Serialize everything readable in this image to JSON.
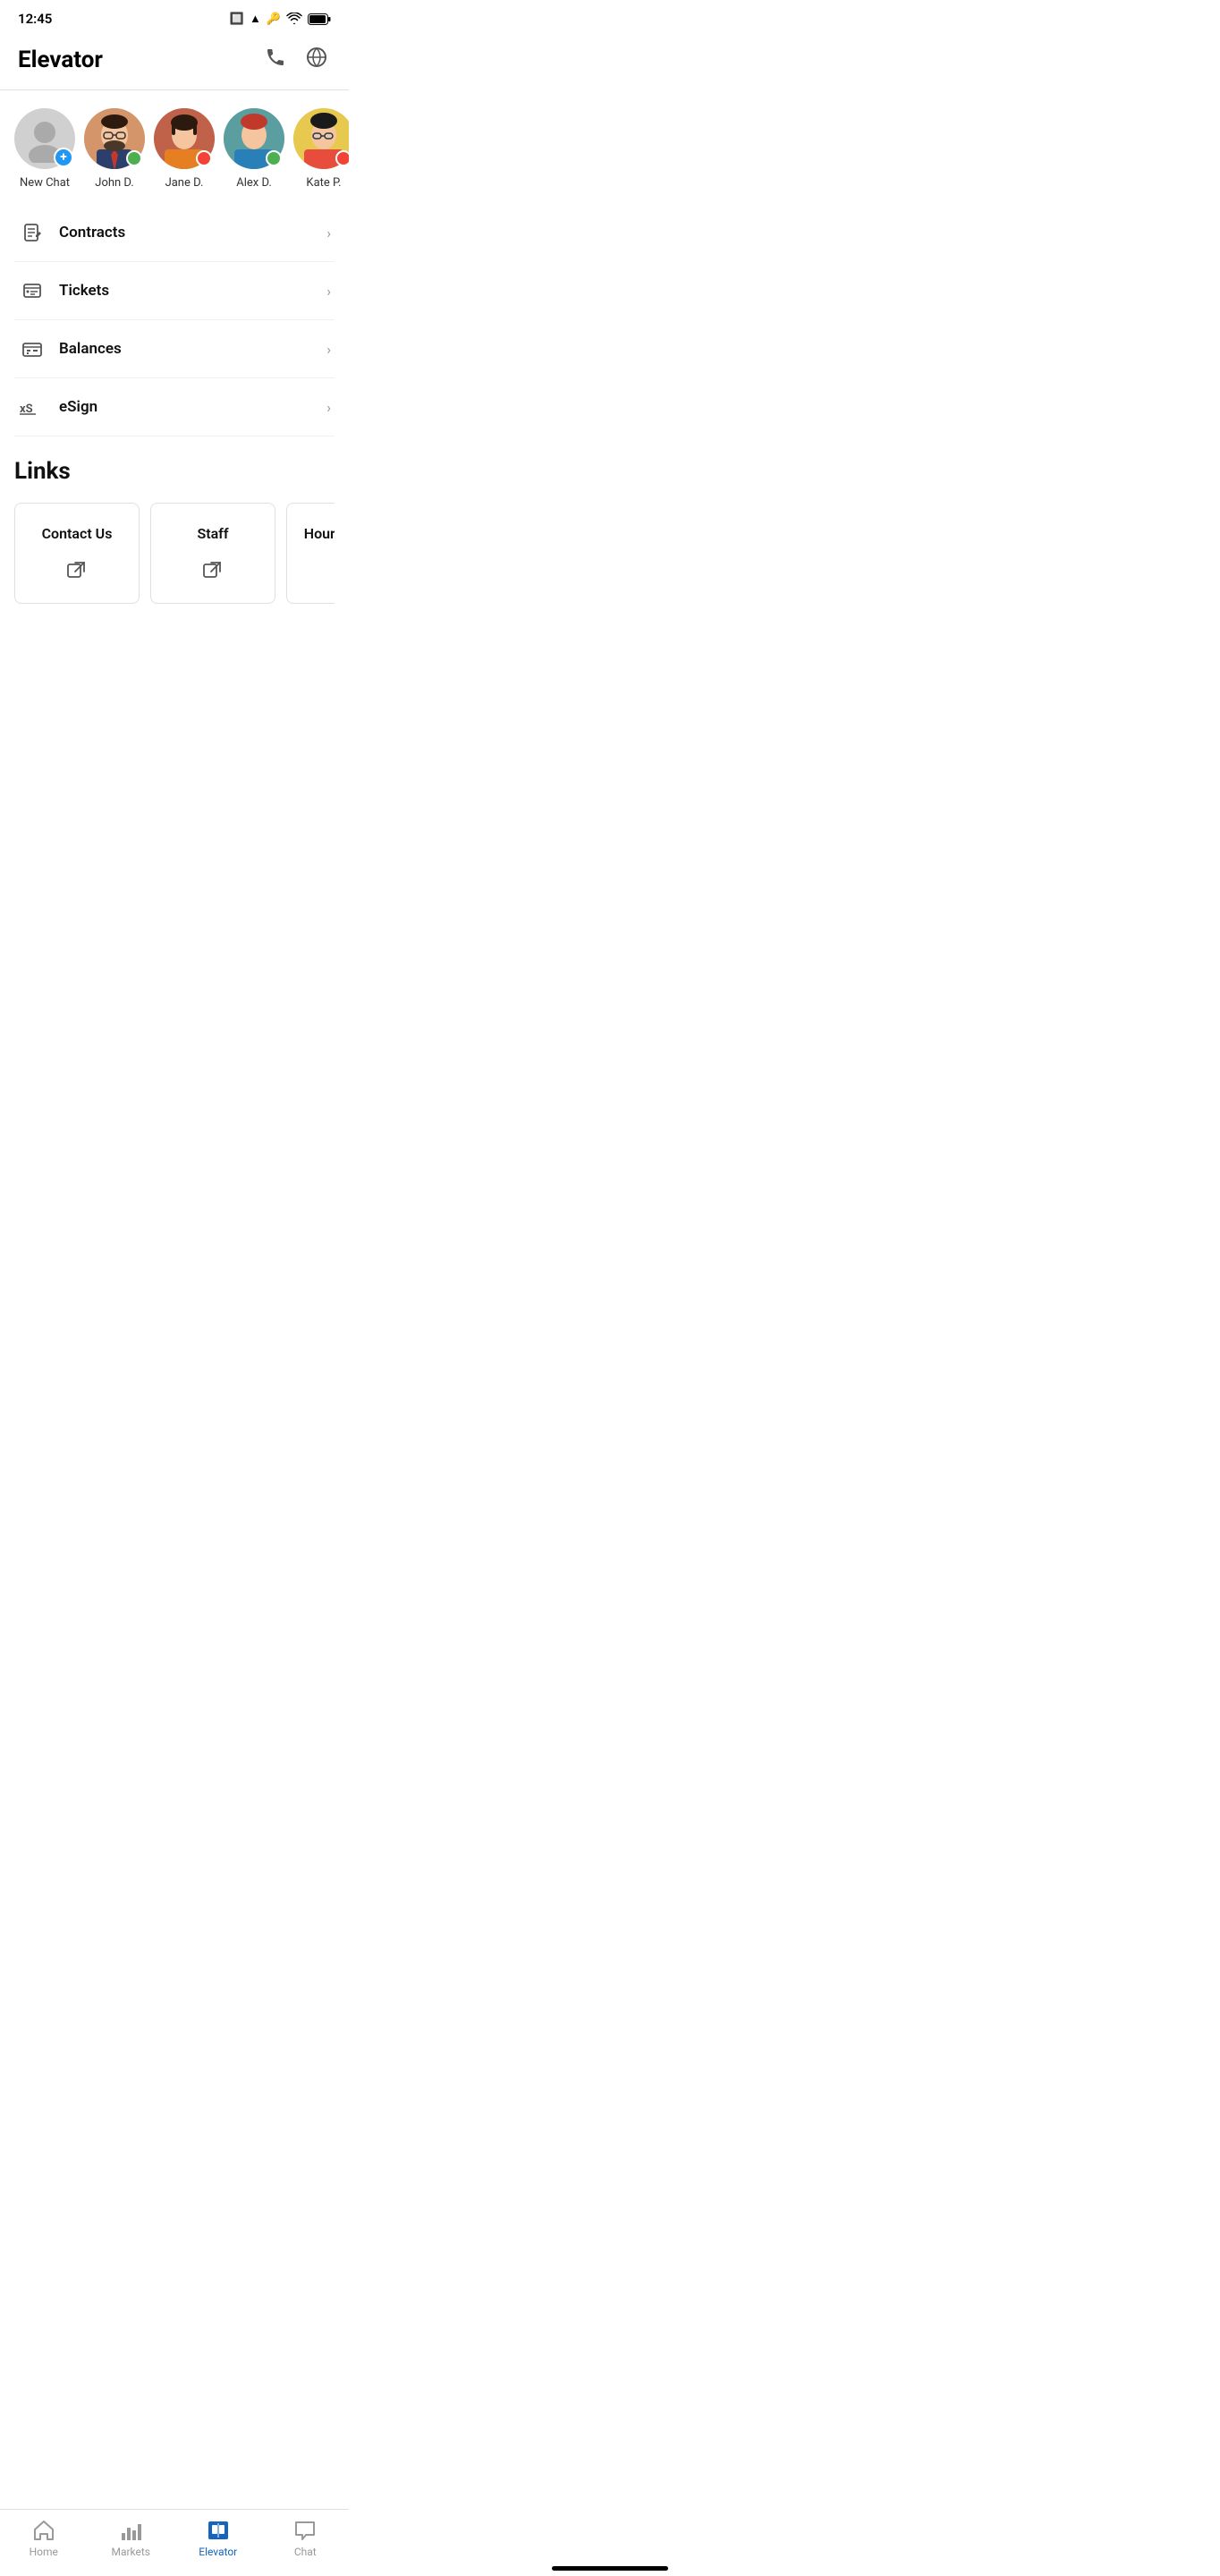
{
  "statusBar": {
    "time": "12:45",
    "icons": [
      "wifi",
      "battery"
    ]
  },
  "header": {
    "title": "Elevator",
    "phoneIcon": "📞",
    "globeIcon": "🌐"
  },
  "contacts": [
    {
      "id": "new-chat",
      "name": "New Chat",
      "avatarType": "new-chat",
      "statusType": "plus"
    },
    {
      "id": "john",
      "name": "John D.",
      "avatarType": "john",
      "statusType": "green"
    },
    {
      "id": "jane",
      "name": "Jane D.",
      "avatarType": "jane",
      "statusType": "red"
    },
    {
      "id": "alex",
      "name": "Alex D.",
      "avatarType": "alex",
      "statusType": "green"
    },
    {
      "id": "kate",
      "name": "Kate P.",
      "avatarType": "kate",
      "statusType": "red"
    }
  ],
  "menuItems": [
    {
      "id": "contracts",
      "label": "Contracts",
      "icon": "contracts"
    },
    {
      "id": "tickets",
      "label": "Tickets",
      "icon": "tickets"
    },
    {
      "id": "balances",
      "label": "Balances",
      "icon": "balances"
    },
    {
      "id": "esign",
      "label": "eSign",
      "icon": "esign"
    }
  ],
  "links": {
    "title": "Links",
    "items": [
      {
        "id": "contact-us",
        "label": "Contact Us"
      },
      {
        "id": "staff",
        "label": "Staff"
      },
      {
        "id": "hours-exam",
        "label": "Hours Exam..."
      }
    ]
  },
  "bottomNav": {
    "items": [
      {
        "id": "home",
        "label": "Home",
        "active": false
      },
      {
        "id": "markets",
        "label": "Markets",
        "active": false
      },
      {
        "id": "elevator",
        "label": "Elevator",
        "active": true
      },
      {
        "id": "chat",
        "label": "Chat",
        "active": false
      }
    ]
  }
}
